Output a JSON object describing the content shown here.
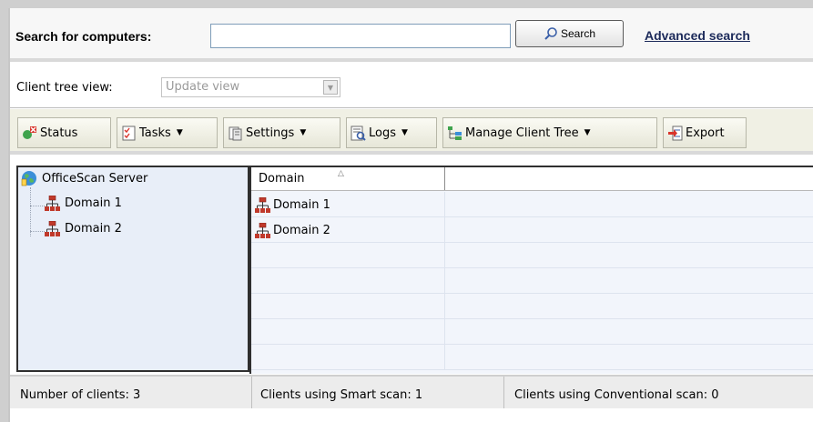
{
  "search": {
    "label": "Search for computers:",
    "input_value": "",
    "button_label": "Search",
    "advanced_link": "Advanced search"
  },
  "tree_view": {
    "label": "Client tree view:",
    "selected": "Update view"
  },
  "toolbar": {
    "status": "Status",
    "tasks": "Tasks",
    "settings": "Settings",
    "logs": "Logs",
    "manage": "Manage Client Tree",
    "export": "Export"
  },
  "tree": {
    "root": "OfficeScan Server",
    "children": [
      "Domain 1",
      "Domain 2"
    ]
  },
  "grid": {
    "column": "Domain",
    "rows": [
      "Domain 1",
      "Domain 2"
    ]
  },
  "status": {
    "clients": "Number of clients: 3",
    "smart": "Clients using Smart scan: 1",
    "conventional": "Clients using Conventional scan: 0"
  },
  "icons": {
    "search": "magnifier-icon",
    "status": "status-icon",
    "tasks": "tasks-icon",
    "settings": "settings-icon",
    "logs": "logs-icon",
    "manage": "tree-icon",
    "export": "export-icon",
    "server": "server-globe-icon",
    "domain": "domain-network-icon"
  },
  "colors": {
    "tree_bg": "#e8eef8",
    "toolbar_bg": "#f0f0e4",
    "link": "#1c2a5a",
    "domain_icon": "#c0392b"
  }
}
